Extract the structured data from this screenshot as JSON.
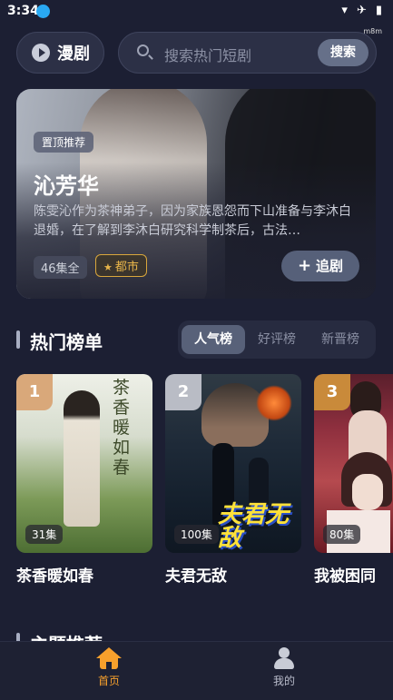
{
  "status": {
    "time": "3:34",
    "tiny": "m8m"
  },
  "header": {
    "brand": "漫剧",
    "search_placeholder": "搜索热门短剧",
    "search_button": "搜索"
  },
  "hero": {
    "tag": "置顶推荐",
    "title": "沁芳华",
    "description": "陈雯沁作为茶神弟子，因为家族恩怨而下山准备与李沐白退婚，在了解到李沐白研究科学制茶后，古法…",
    "episodes": "46集全",
    "genre": "都市",
    "follow_button": "追剧"
  },
  "ranking": {
    "title": "热门榜单",
    "tabs": [
      "人气榜",
      "好评榜",
      "新晋榜"
    ],
    "active_tab": "人气榜",
    "cards": [
      {
        "rank": "1",
        "episodes": "31集",
        "title": "茶香暖如春",
        "poster_text": "茶香暖如春",
        "badge_color": "#d9a87a"
      },
      {
        "rank": "2",
        "episodes": "100集",
        "title": "夫君无敌",
        "poster_text": "夫君无敌",
        "badge_color": "#b9bcc5"
      },
      {
        "rank": "3",
        "episodes": "80集",
        "title": "我被困同",
        "poster_text": "",
        "badge_color": "#c98a3a"
      }
    ]
  },
  "next_section": {
    "title": "主题推荐"
  },
  "bottom_nav": {
    "items": [
      {
        "label": "首页",
        "icon": "home-icon",
        "active": true
      },
      {
        "label": "我的",
        "icon": "user-icon",
        "active": false
      }
    ]
  }
}
